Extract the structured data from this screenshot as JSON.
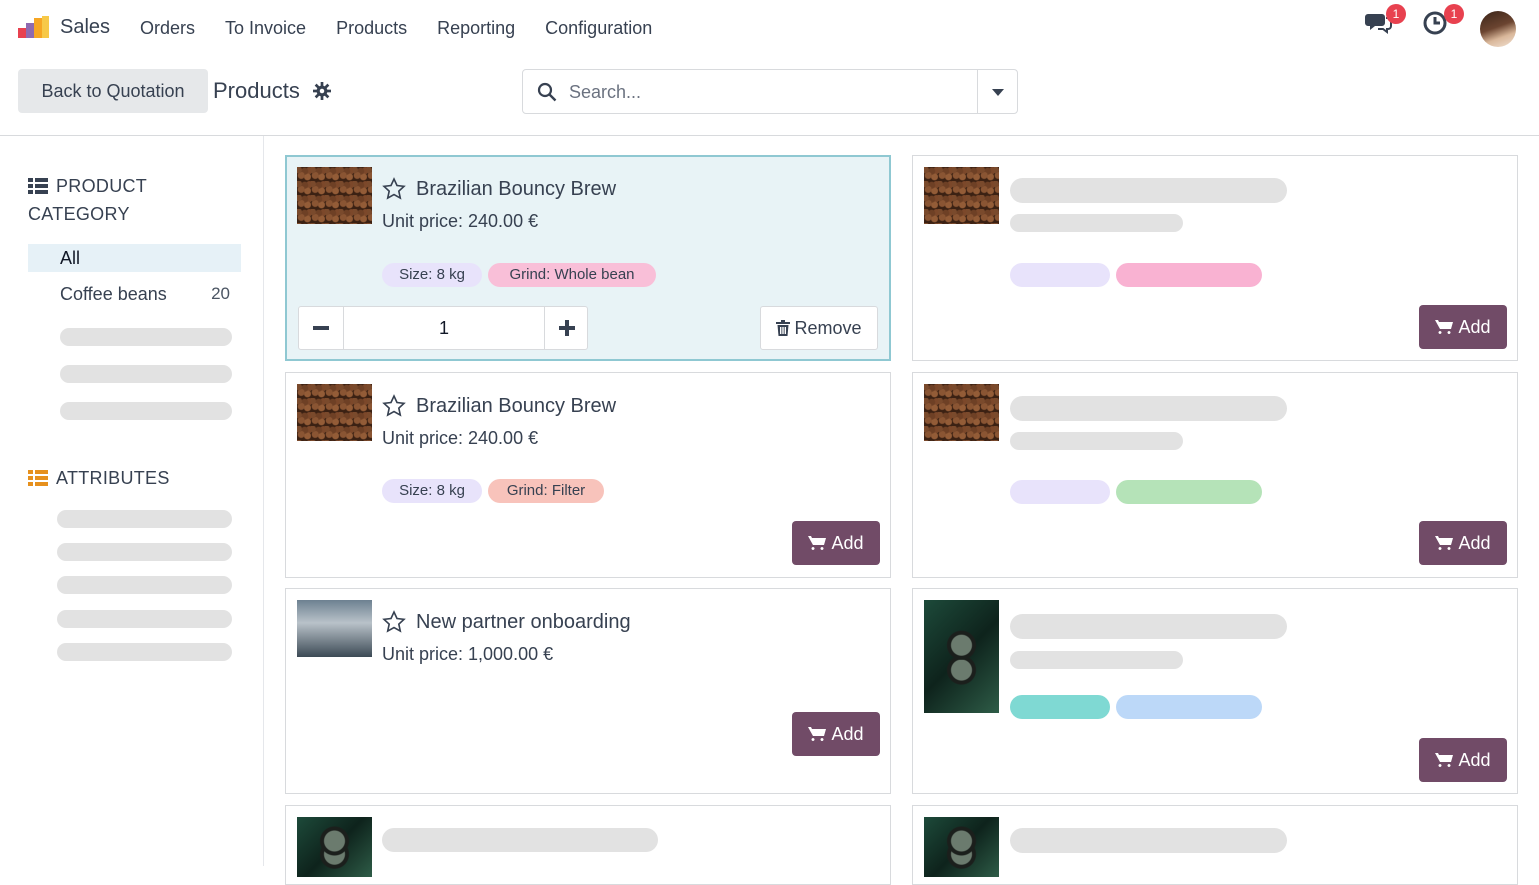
{
  "navbar": {
    "app_name": "Sales",
    "menu": [
      "Orders",
      "To Invoice",
      "Products",
      "Reporting",
      "Configuration"
    ],
    "messages_badge": "1",
    "activities_badge": "1"
  },
  "control": {
    "back_label": "Back to Quotation",
    "breadcrumb": "Products",
    "search_placeholder": "Search..."
  },
  "sidebar": {
    "category_heading_line1": "PRODUCT",
    "category_heading_line2": "CATEGORY",
    "all_label": "All",
    "items": [
      {
        "label": "Coffee beans",
        "count": "20"
      }
    ],
    "attributes_heading": "ATTRIBUTES"
  },
  "products": [
    {
      "name": "Brazilian Bouncy Brew",
      "price": "Unit price: 240.00 €",
      "tags": [
        "Size: 8 kg",
        "Grind: Whole bean"
      ],
      "qty": "1",
      "remove_label": "Remove"
    },
    {
      "name": "Brazilian Bouncy Brew",
      "price": "Unit price: 240.00 €",
      "tags": [
        "Size: 8 kg",
        "Grind: Filter"
      ],
      "add_label": "Add"
    },
    {
      "name": "New partner onboarding",
      "price": "Unit price: 1,000.00 €",
      "add_label": "Add"
    }
  ],
  "placeholder_add_label": "Add",
  "colors": {
    "primary": "#714b67",
    "selected_bg": "#e8f3f6",
    "selected_border": "#8fc8d2",
    "badge": "#e8414f",
    "tag_size": "#e8e3fb",
    "tag_whole_bean": "#f9bfd8",
    "tag_filter": "#f8c3bb"
  }
}
